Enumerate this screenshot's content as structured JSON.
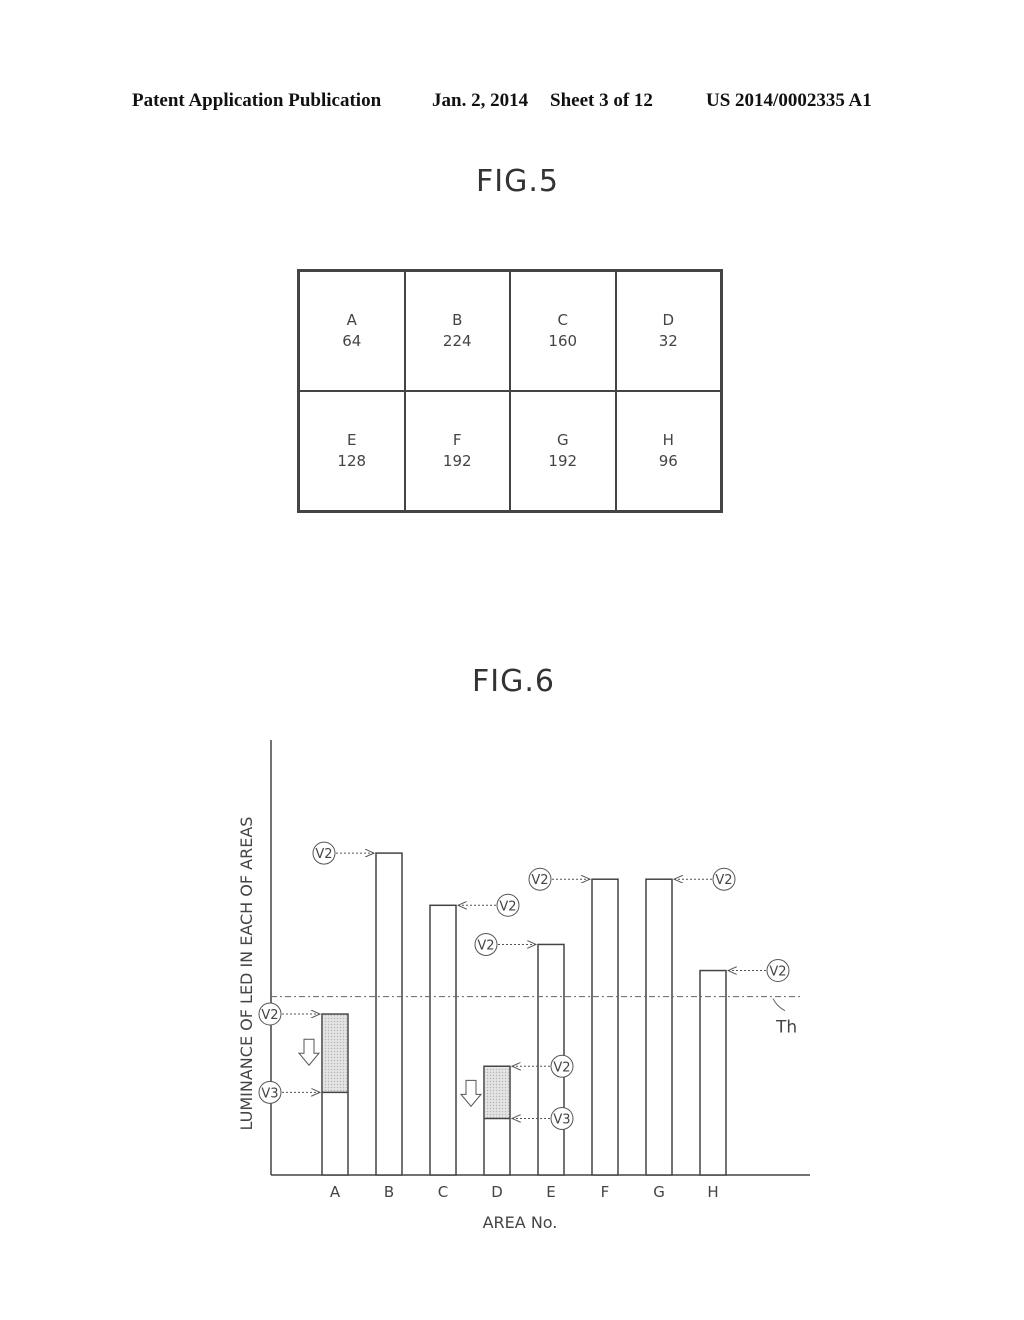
{
  "header": {
    "publication": "Patent Application Publication",
    "date": "Jan. 2, 2014",
    "sheet": "Sheet 3 of 12",
    "number": "US 2014/0002335 A1"
  },
  "fig5": {
    "title": "FIG.5",
    "cells": [
      {
        "area": "A",
        "value": "64"
      },
      {
        "area": "B",
        "value": "224"
      },
      {
        "area": "C",
        "value": "160"
      },
      {
        "area": "D",
        "value": "32"
      },
      {
        "area": "E",
        "value": "128"
      },
      {
        "area": "F",
        "value": "192"
      },
      {
        "area": "G",
        "value": "192"
      },
      {
        "area": "H",
        "value": "96"
      }
    ]
  },
  "fig6": {
    "title": "FIG.6"
  },
  "chart_data": {
    "type": "bar",
    "title": "FIG.6",
    "xlabel": "AREA No.",
    "ylabel": "LUMINANCE OF LED IN EACH OF AREAS",
    "categories": [
      "A",
      "B",
      "C",
      "D",
      "E",
      "F",
      "G",
      "H"
    ],
    "ylim": [
      0,
      100
    ],
    "units": "relative (schematic, not to scale)",
    "series": [
      {
        "name": "V2",
        "values": [
          37,
          74,
          62,
          25,
          53,
          68,
          68,
          47
        ]
      },
      {
        "name": "V3",
        "values": [
          19,
          null,
          null,
          13,
          null,
          null,
          null,
          null
        ]
      }
    ],
    "threshold": {
      "label": "Th",
      "value": 41
    },
    "reduced_areas": [
      "A",
      "D"
    ],
    "annotations": {
      "v2_label": "V2",
      "v3_label": "V3",
      "v2_callout_sides": [
        "left",
        "left",
        "right",
        "right",
        "left",
        "left",
        "right",
        "right"
      ]
    },
    "grid": false,
    "legend": "none"
  }
}
